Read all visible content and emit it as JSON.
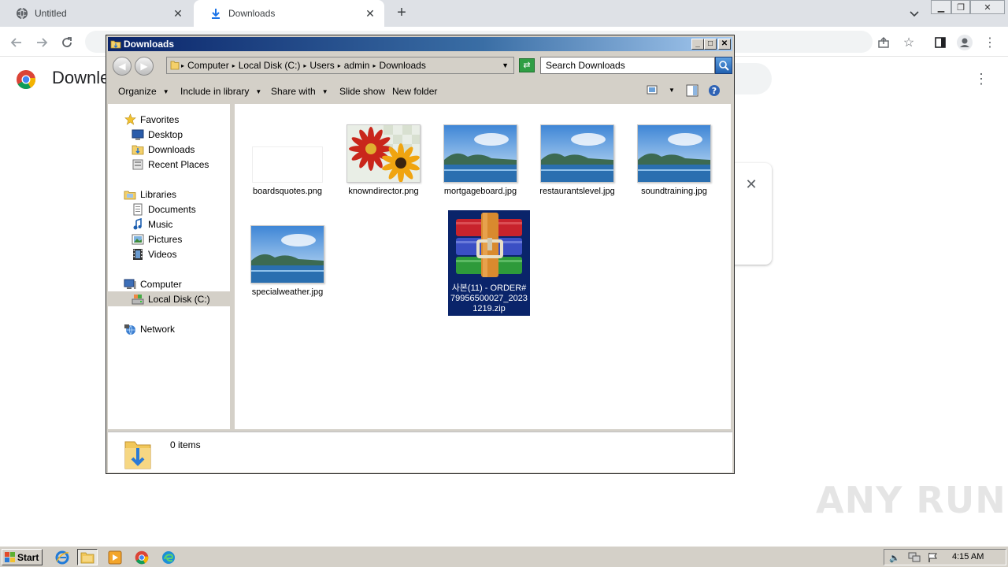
{
  "browser": {
    "tabs": [
      {
        "label": "Untitled",
        "icon": "globe-icon"
      },
      {
        "label": "Downloads",
        "icon": "download-icon"
      }
    ],
    "page_title": "Downle"
  },
  "explorer": {
    "title": "Downloads",
    "address": {
      "crumbs": [
        "Computer",
        "Local Disk (C:)",
        "Users",
        "admin",
        "Downloads"
      ]
    },
    "search_placeholder": "Search Downloads",
    "commands": {
      "organize": "Organize",
      "include_in_library": "Include in library",
      "share_with": "Share with",
      "slide_show": "Slide show",
      "new_folder": "New folder"
    },
    "nav": {
      "favorites": "Favorites",
      "desktop": "Desktop",
      "downloads": "Downloads",
      "recent_places": "Recent Places",
      "libraries": "Libraries",
      "documents": "Documents",
      "music": "Music",
      "pictures": "Pictures",
      "videos": "Videos",
      "computer": "Computer",
      "local_disk": "Local Disk (C:)",
      "network": "Network"
    },
    "files": [
      {
        "name": "boardsquotes.png",
        "thumb": "blank"
      },
      {
        "name": "knowndirector.png",
        "thumb": "flowers"
      },
      {
        "name": "mortgageboard.jpg",
        "thumb": "landscape"
      },
      {
        "name": "restaurantslevel.jpg",
        "thumb": "landscape"
      },
      {
        "name": "soundtraining.jpg",
        "thumb": "landscape"
      },
      {
        "name": "specialweather.jpg",
        "thumb": "landscape"
      },
      {
        "name": "사본(11) - ORDER#79956500027_20231219.zip",
        "thumb": "winrar-archive"
      }
    ],
    "status": "0 items"
  },
  "taskbar": {
    "start_label": "Start",
    "clock": "4:15 AM"
  },
  "watermark": "ANY RUN"
}
